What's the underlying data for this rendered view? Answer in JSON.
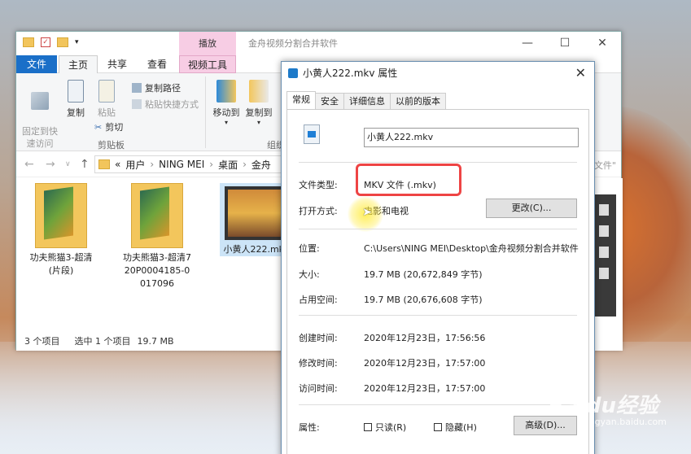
{
  "explorer": {
    "context_tab": "播放",
    "window_title": "金舟视频分割合并软件",
    "tabs": {
      "file": "文件",
      "home": "主页",
      "share": "共享",
      "view": "查看",
      "video_tools": "视频工具"
    },
    "ribbon": {
      "pin": "固定到快\n速访问",
      "copy": "复制",
      "paste": "粘贴",
      "copy_path": "复制路径",
      "paste_shortcut": "粘贴快捷方式",
      "cut": "剪切",
      "clipboard_group": "剪贴板",
      "move_to": "移动到",
      "copy_to": "复制到",
      "organize_group": "组织"
    },
    "breadcrumb": [
      "«",
      "用户",
      "NING MEI",
      "桌面",
      "金舟"
    ],
    "items": [
      {
        "name": "功夫熊猫3-超清(片段)"
      },
      {
        "name": "功夫熊猫3-超清720P0004185-0017096"
      },
      {
        "name": "小黄人222.mkv"
      }
    ],
    "status": {
      "count": "3 个项目",
      "selected": "选中 1 个项目",
      "size": "19.7 MB"
    },
    "right_hint": "文件\""
  },
  "dialog": {
    "title": "小黄人222.mkv 属性",
    "tabs": [
      "常规",
      "安全",
      "详细信息",
      "以前的版本"
    ],
    "filename": "小黄人222.mkv",
    "rows": {
      "type_label": "文件类型:",
      "type_value": "MKV 文件 (.mkv)",
      "open_label": "打开方式:",
      "open_value": "电影和电视",
      "change_button": "更改(C)...",
      "location_label": "位置:",
      "location_value": "C:\\Users\\NING MEI\\Desktop\\金舟视频分割合并软件",
      "size_label": "大小:",
      "size_value": "19.7 MB (20,672,849 字节)",
      "disk_label": "占用空间:",
      "disk_value": "19.7 MB (20,676,608 字节)",
      "created_label": "创建时间:",
      "created_value": "2020年12月23日，17:56:56",
      "modified_label": "修改时间:",
      "modified_value": "2020年12月23日，17:57:00",
      "accessed_label": "访问时间:",
      "accessed_value": "2020年12月23日，17:57:00",
      "attr_label": "属性:",
      "readonly": "只读(R)",
      "hidden": "隐藏(H)",
      "advanced_button": "高级(D)..."
    }
  },
  "watermark": {
    "brand": "Baidu经验",
    "url": "jingyan.baidu.com"
  }
}
